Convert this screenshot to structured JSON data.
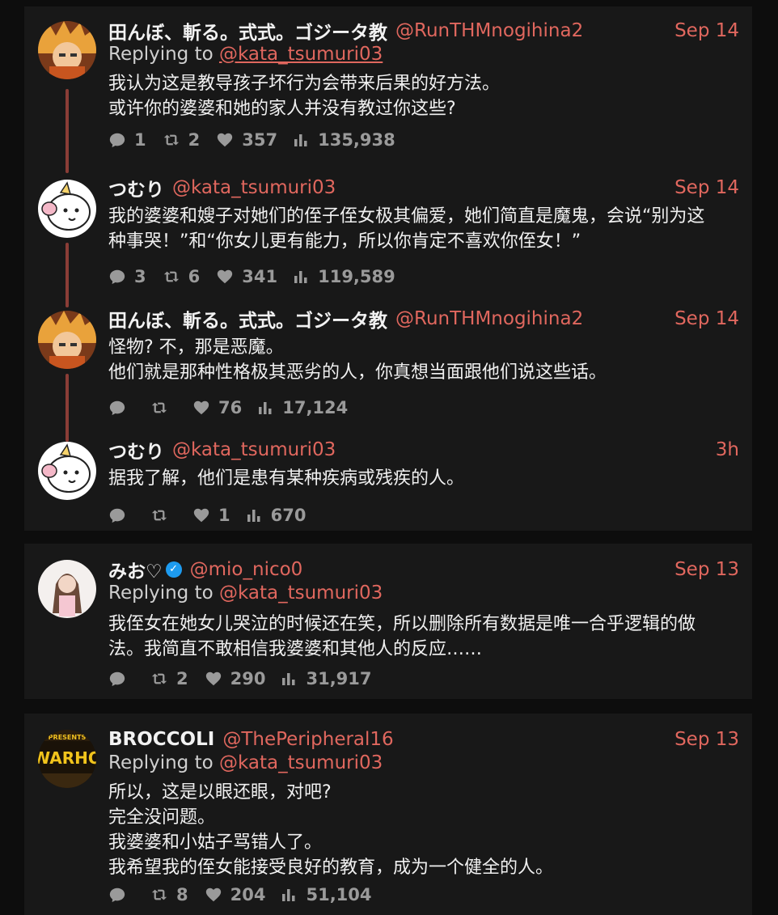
{
  "thread1": {
    "tweets": [
      {
        "name": "田んぼ、斬る。式式。ゴジータ教",
        "handle": "@RunTHMnogihina2",
        "date": "Sep 14",
        "replying_label": "Replying to",
        "replying_to": "@kata_tsumuri03",
        "lines": [
          "我认为这是教导孩子坏行为会带来后果的好方法。",
          "或许你的婆婆和她的家人并没有教过你这些?"
        ],
        "replies": "1",
        "retweets": "2",
        "likes": "357",
        "views": "135,938"
      },
      {
        "name": "つむり",
        "handle": "@kata_tsumuri03",
        "date": "Sep 14",
        "lines": [
          "我的婆婆和嫂子对她们的侄子侄女极其偏爱，她们简直是魔鬼，会说“别为这",
          "种事哭！”和“你女儿更有能力，所以你肯定不喜欢你侄女！”"
        ],
        "replies": "3",
        "retweets": "6",
        "likes": "341",
        "views": "119,589"
      },
      {
        "name": "田んぼ、斬る。式式。ゴジータ教",
        "handle": "@RunTHMnogihina2",
        "date": "Sep 14",
        "lines": [
          "怪物? 不，那是恶魔。",
          "他们就是那种性格极其恶劣的人，你真想当面跟他们说这些话。"
        ],
        "replies": "",
        "retweets": "",
        "likes": "76",
        "views": "17,124"
      },
      {
        "name": "つむり",
        "handle": "@kata_tsumuri03",
        "date": "3h",
        "lines": [
          "据我了解，他们是患有某种疾病或残疾的人。"
        ],
        "replies": "",
        "retweets": "",
        "likes": "1",
        "views": "670"
      }
    ]
  },
  "tweet_mio": {
    "name": "みお♡",
    "handle": "@mio_nico0",
    "date": "Sep 13",
    "replying_label": "Replying to",
    "replying_to": "@kata_tsumuri03",
    "lines": [
      "我侄女在她女儿哭泣的时候还在笑，所以删除所有数据是唯一合乎逻辑的做",
      "法。我简直不敢相信我婆婆和其他人的反应……"
    ],
    "replies": "",
    "retweets": "2",
    "likes": "290",
    "views": "31,917"
  },
  "tweet_broccoli": {
    "name": "BROCCOLI",
    "handle": "@ThePeripheral16",
    "date": "Sep 13",
    "replying_label": "Replying to",
    "replying_to": "@kata_tsumuri03",
    "avatar_text_top": "PRESENTS",
    "avatar_text_mid": "WARHO",
    "lines": [
      "所以，这是以眼还眼，对吧?",
      "完全没问题。",
      "我婆婆和小姑子骂错人了。",
      "我希望我的侄女能接受良好的教育，成为一个健全的人。"
    ],
    "replies": "",
    "retweets": "8",
    "likes": "204",
    "views": "51,104"
  },
  "colors": {
    "accent": "#e0675e",
    "thread_line": "#8a3d36",
    "card_bg": "#181818",
    "page_bg": "#0d0d0d",
    "muted": "#9a9a9a",
    "verified": "#1d9bf0"
  },
  "icons": [
    "reply-icon",
    "retweet-icon",
    "like-icon",
    "views-icon",
    "verified-icon"
  ]
}
